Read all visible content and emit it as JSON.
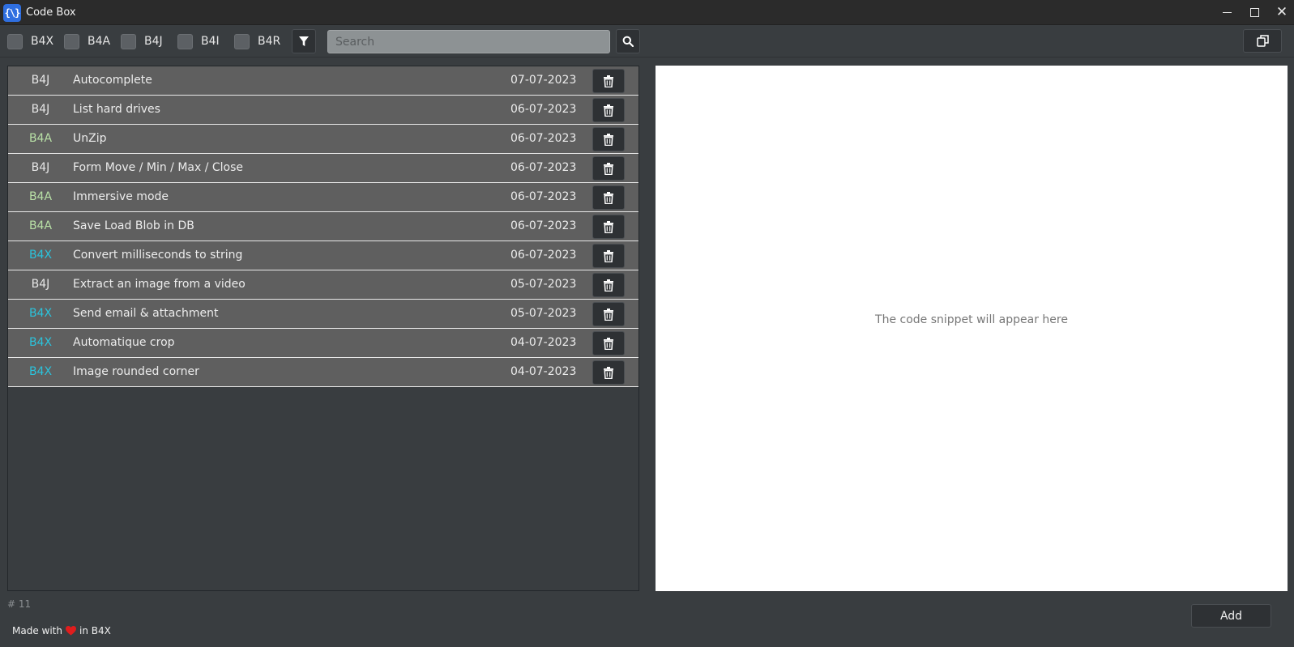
{
  "window": {
    "app_icon_text": "{\\}",
    "title": "Code Box",
    "minimize_icon": "minimize-icon",
    "maximize_icon": "maximize-icon",
    "close_glyph": "✕"
  },
  "toolbar": {
    "filters": [
      {
        "label": "B4X",
        "checked": false
      },
      {
        "label": "B4A",
        "checked": false
      },
      {
        "label": "B4J",
        "checked": false
      },
      {
        "label": "B4I",
        "checked": false
      },
      {
        "label": "B4R",
        "checked": false
      }
    ],
    "filter_icon": "funnel-icon",
    "search_placeholder": "Search",
    "search_value": "",
    "search_icon": "magnifier-icon",
    "copy_icon": "copy-icon"
  },
  "colors": {
    "B4J": "#e6e6e6",
    "B4A": "#b8e0a6",
    "B4X": "#2bc3dc"
  },
  "snippets": [
    {
      "tag": "B4J",
      "title": "Autocomplete",
      "date": "07-07-2023"
    },
    {
      "tag": "B4J",
      "title": "List hard drives",
      "date": "06-07-2023"
    },
    {
      "tag": "B4A",
      "title": "UnZip",
      "date": "06-07-2023"
    },
    {
      "tag": "B4J",
      "title": "Form Move / Min / Max / Close",
      "date": "06-07-2023"
    },
    {
      "tag": "B4A",
      "title": "Immersive mode",
      "date": "06-07-2023"
    },
    {
      "tag": "B4A",
      "title": "Save Load Blob in DB",
      "date": "06-07-2023"
    },
    {
      "tag": "B4X",
      "title": "Convert milliseconds to string",
      "date": "06-07-2023"
    },
    {
      "tag": "B4J",
      "title": "Extract an image from a video",
      "date": "05-07-2023"
    },
    {
      "tag": "B4X",
      "title": "Send email & attachment",
      "date": "05-07-2023"
    },
    {
      "tag": "B4X",
      "title": "Automatique crop",
      "date": "04-07-2023"
    },
    {
      "tag": "B4X",
      "title": "Image rounded corner",
      "date": "04-07-2023"
    }
  ],
  "delete_icon": "trash-icon",
  "code_panel": {
    "placeholder": "The code snippet will appear here"
  },
  "footer": {
    "count": "# 11",
    "made_prefix": "Made with",
    "made_suffix": "in B4X",
    "heart_icon": "heart-icon",
    "add_label": "Add"
  }
}
